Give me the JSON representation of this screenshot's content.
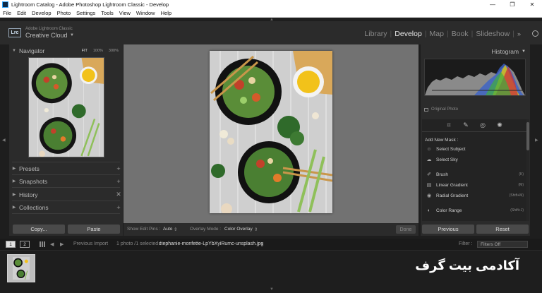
{
  "window": {
    "title": "Lightroom Catalog - Adobe Photoshop Lightroom Classic - Develop",
    "controls": [
      "—",
      "❐",
      "✕"
    ]
  },
  "menu": [
    "File",
    "Edit",
    "Develop",
    "Photo",
    "Settings",
    "Tools",
    "View",
    "Window",
    "Help"
  ],
  "brand": {
    "logo": "Lrc",
    "line1": "Adobe Lightroom Classic",
    "line2": "Creative Cloud"
  },
  "modules": {
    "items": [
      "Library",
      "Develop",
      "Map",
      "Book",
      "Slideshow"
    ],
    "active": "Develop",
    "more": "»"
  },
  "left": {
    "navigator": {
      "title": "Navigator",
      "zoom": [
        "FIT",
        "100%",
        "300%"
      ]
    },
    "panels": [
      "Presets",
      "Snapshots",
      "History",
      "Collections"
    ],
    "copy_label": "Copy...",
    "paste_label": "Paste"
  },
  "toolbar": {
    "show_edit_pins_label": "Show Edit Pins :",
    "show_edit_pins_value": "Auto",
    "overlay_mode_label": "Overlay Mode :",
    "overlay_mode_value": "Color Overlay",
    "done_label": "Done"
  },
  "right": {
    "histogram_title": "Histogram",
    "original_photo_label": "Original Photo",
    "add_new_mask": "Add New Mask :",
    "masks": [
      {
        "name": "Select Subject",
        "key": "",
        "icon": "select-subject-icon"
      },
      {
        "name": "Select Sky",
        "key": "",
        "icon": "select-sky-icon"
      },
      {
        "name": "Brush",
        "key": "(K)",
        "icon": "brush-icon"
      },
      {
        "name": "Linear Gradient",
        "key": "(M)",
        "icon": "linear-gradient-icon"
      },
      {
        "name": "Radial Gradient",
        "key": "(Shift+M)",
        "icon": "radial-gradient-icon"
      },
      {
        "name": "Color Range",
        "key": "(Shift+J)",
        "icon": "color-range-icon"
      }
    ],
    "previous_label": "Previous",
    "reset_label": "Reset"
  },
  "filmbar": {
    "monitor1": "1",
    "monitor2": "2",
    "previous_import": "Previous Import",
    "selection_info": "1 photo /1 selected /",
    "filename": "stephanie-monfette-LpYbXyiRumc-unsplash.jpg",
    "filter_label": "Filter :",
    "filter_value": "Filters Off"
  },
  "watermark": "آکادمی بیت گرف",
  "colors": {
    "panel_bg": "#2b2b2b",
    "canvas_bg": "#727272",
    "button_bg": "#4a4a4a",
    "active_module": "#e6e6e6"
  }
}
